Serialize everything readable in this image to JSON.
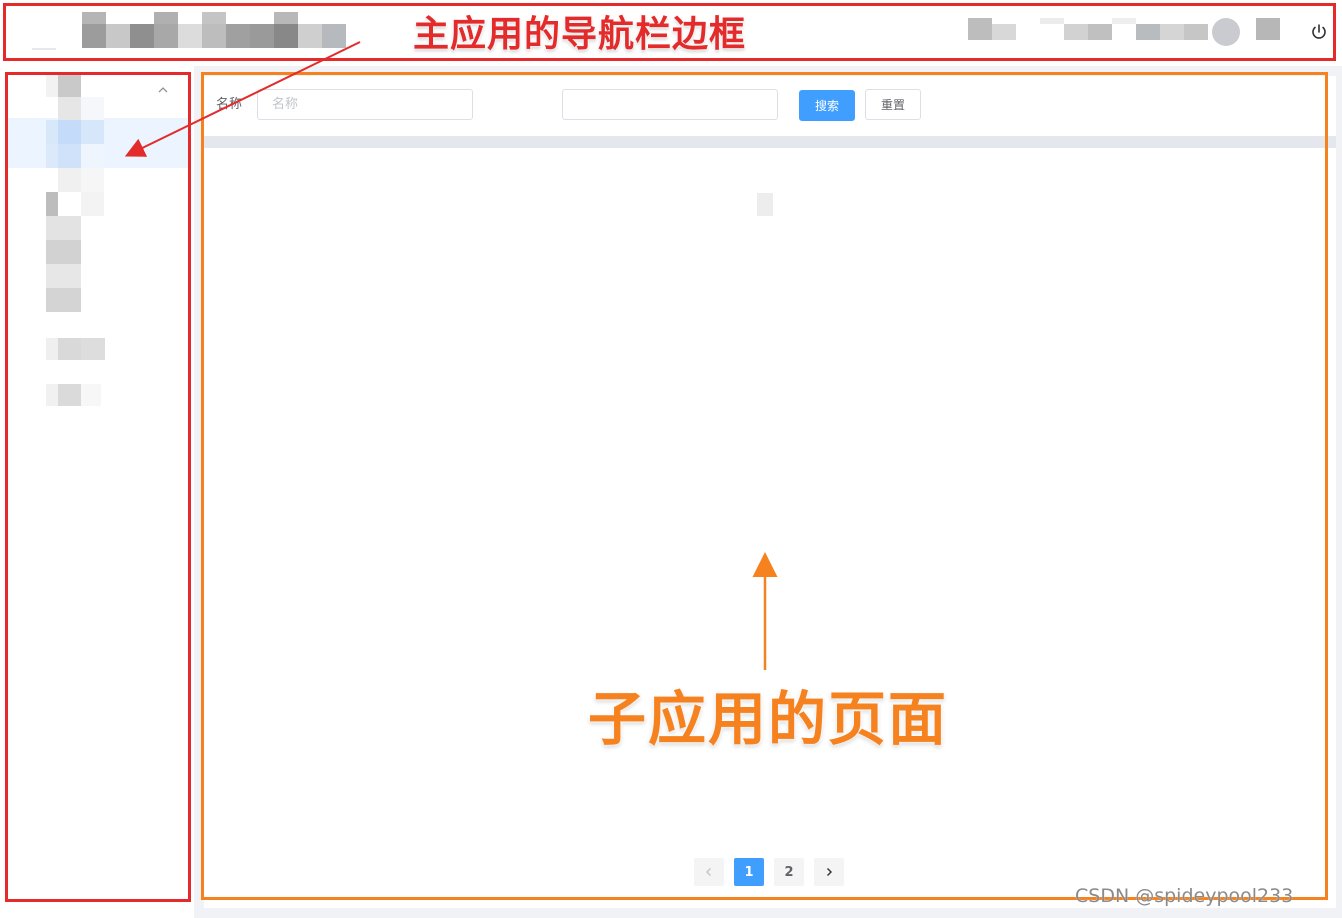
{
  "colors": {
    "primary": "#409eff",
    "annotation_red": "#e32b2b",
    "annotation_orange": "#f5821f",
    "sidebar_active": "#ecf5ff"
  },
  "header": {
    "logout_icon": "power-icon"
  },
  "sidebar": {
    "collapse_icon": "chevron-up-icon"
  },
  "filter": {
    "name_label": "名称",
    "name_placeholder": "名称",
    "search_label": "搜索",
    "reset_label": "重置"
  },
  "pagination": {
    "prev_icon": "chevron-left-icon",
    "pages": [
      "1",
      "2"
    ],
    "current": "1",
    "next_icon": "chevron-right-icon"
  },
  "annotations": {
    "nav_frame": "主应用的导航栏边框",
    "sub_app_page": "子应用的页面"
  },
  "watermark": "CSDN @spideypool233"
}
